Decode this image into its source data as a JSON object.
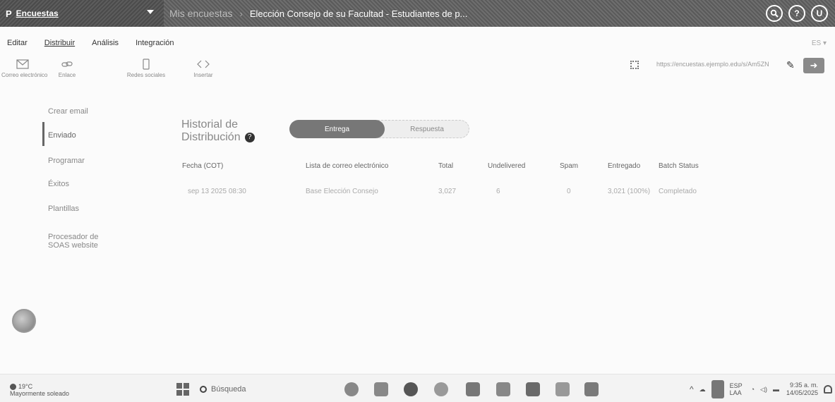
{
  "topbar": {
    "logo": "P",
    "app_name": "Encuestas",
    "breadcrumb_root": "Mis encuestas",
    "breadcrumb_current": "Elección Consejo de su Facultad - Estudiantes de p...",
    "icons": [
      "search-icon",
      "help-icon",
      "user-icon"
    ],
    "help_glyph": "?",
    "user_initial": "U"
  },
  "menubar": {
    "items": [
      "Editar",
      "Distribuir",
      "Análisis",
      "Integración"
    ],
    "active": "Distribuir",
    "lang": "ES ▾"
  },
  "toolbar": {
    "tools": [
      {
        "label": "Correo electrónico",
        "icon": "envelope-icon"
      },
      {
        "label": "Enlace",
        "icon": "link-icon"
      },
      {
        "label": "Redes sociales",
        "icon": "share-icon"
      },
      {
        "label": "Insertar",
        "icon": "embed-icon"
      }
    ],
    "link": "https://encuestas.ejemplo.edu/s/Am5ZN",
    "qr_icon": "qr-code-icon",
    "edit_icon": "pencil-icon",
    "go_icon": "arrow-right-icon"
  },
  "sidebar": {
    "items": [
      "Crear email",
      "Enviado",
      "Programar",
      "Éxitos",
      "Plantillas",
      "Procesador de SOAS website"
    ],
    "active": "Enviado"
  },
  "main": {
    "title_line1": "Historial de",
    "title_line2": "Distribución",
    "help_glyph": "?",
    "toggle": {
      "on": "Entrega",
      "off": "Respuesta"
    },
    "columns": [
      "Fecha (COT)",
      "Lista de correo electrónico",
      "Total",
      "Undelivered",
      "Spam",
      "Entregado",
      "Batch Status"
    ],
    "row": {
      "date": "sep 13 2025 08:30",
      "list": "Base Elección Consejo",
      "total": "3,027",
      "undelivered": "6",
      "spam": "0",
      "delivered": "3,021 (100%)",
      "status": "Completado"
    }
  },
  "taskbar": {
    "temp": "19°C",
    "weather": "Mayormente soleado",
    "search_label": "Búsqueda",
    "lang": "ESP",
    "lang_sub": "LAA",
    "time": "9:35 a. m.",
    "date": "14/05/2025"
  },
  "colors": {
    "topbar": "#5e5e5e",
    "accent": "#777777",
    "page_bg": "#fbfbfb"
  }
}
